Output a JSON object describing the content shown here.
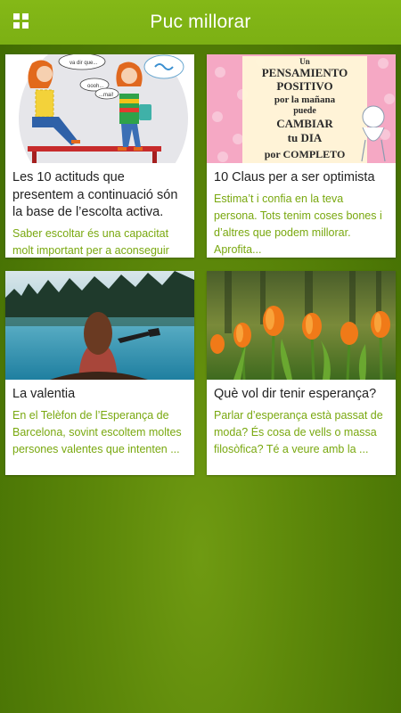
{
  "header": {
    "title": "Puc millorar",
    "menu_icon": "grid-menu-icon"
  },
  "cards": [
    {
      "title": "Les 10 actituds que presentem a continuació són la base de l’escolta activa.",
      "snippet": "Saber escoltar és una capacitat molt important per a aconseguir una",
      "image_text": {
        "bubble1": "va dir que...",
        "bubble2": "oooh...",
        "bubble3": "...mai!"
      }
    },
    {
      "title": "10 Claus per a ser optimista",
      "snippet": "Estima’t i confia en la teva persona. Tots tenim coses bones i d’altres que podem millorar. Aprofita...",
      "image_text": [
        "Un",
        "PENSAMIENTO",
        "POSITIVO",
        "por la mañana",
        "puede",
        "CAMBIAR",
        "tu DIA",
        "por COMPLETO"
      ]
    },
    {
      "title": "La valentia",
      "snippet": "En el Telèfon de l’Esperança de Barcelona, sovint escoltem moltes persones valentes que intenten ..."
    },
    {
      "title": "Què vol dir tenir esperança?",
      "snippet": "Parlar d’esperança està passat de moda? És cosa de vells o massa filosòfica? Té a veure amb la ..."
    }
  ],
  "colors": {
    "header": "#7cb014",
    "accent_text": "#79a80f",
    "background": "#5d880a"
  }
}
